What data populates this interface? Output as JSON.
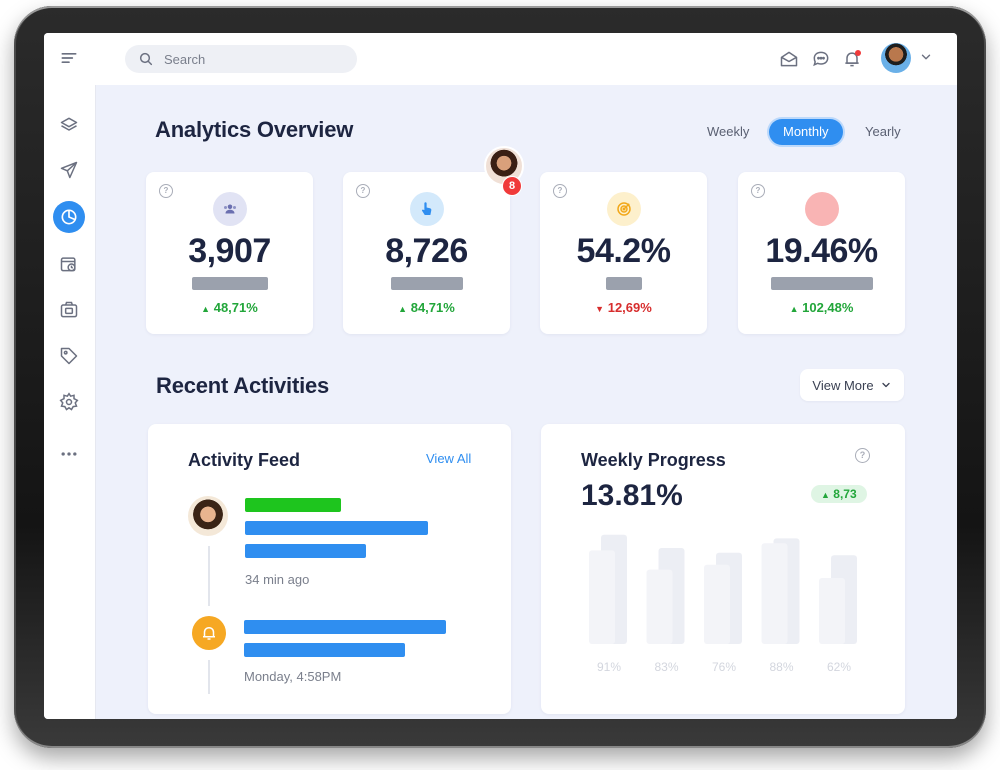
{
  "search": {
    "placeholder": "Search"
  },
  "sidebar": {
    "items": [
      {
        "name": "menu-icon"
      },
      {
        "name": "layers-icon"
      },
      {
        "name": "send-icon"
      },
      {
        "name": "pie-chart-icon",
        "active": true
      },
      {
        "name": "calendar-clock-icon"
      },
      {
        "name": "camera-icon"
      },
      {
        "name": "tag-icon"
      },
      {
        "name": "gear-icon"
      },
      {
        "name": "more-icon"
      }
    ]
  },
  "topbar": {
    "icons": [
      "mail-icon",
      "chat-icon",
      "bell-icon",
      "avatar",
      "chevron-down-icon"
    ]
  },
  "overview": {
    "title": "Analytics Overview",
    "periods": [
      "Weekly",
      "Monthly",
      "Yearly"
    ],
    "active_period": "Monthly",
    "notification_count": "8",
    "cards": [
      {
        "value": "3,907",
        "change": "48,71%",
        "trend": "up",
        "icon": "users-icon",
        "icon_bg": "#e1e3f4",
        "icon_color": "#6a6fb0"
      },
      {
        "value": "8,726",
        "change": "84,71%",
        "trend": "up",
        "icon": "pointer-icon",
        "icon_bg": "#d3e9fb",
        "icon_color": "#2f8ef0"
      },
      {
        "value": "54.2%",
        "change": "12,69%",
        "trend": "down",
        "icon": "target-icon",
        "icon_bg": "#fdf0cc",
        "icon_color": "#f2a81a"
      },
      {
        "value": "19.46%",
        "change": "102,48%",
        "trend": "up",
        "icon": "circle-icon",
        "icon_bg": "#f9b4b4",
        "icon_color": "#f9b4b4"
      }
    ]
  },
  "activities": {
    "title": "Recent Activities",
    "view_more": "View More",
    "feed": {
      "title": "Activity Feed",
      "view_all": "View All",
      "items": [
        {
          "time": "34  min ago"
        },
        {
          "time": "Monday, 4:58PM"
        }
      ]
    },
    "weekly": {
      "title": "Weekly Progress",
      "value": "13.81%",
      "change": "8,73",
      "bars": [
        {
          "label": "91%",
          "back": 0.91,
          "front": 0.78
        },
        {
          "label": "83%",
          "back": 0.8,
          "front": 0.62
        },
        {
          "label": "76%",
          "back": 0.76,
          "front": 0.66
        },
        {
          "label": "88%",
          "back": 0.88,
          "front": 0.84
        },
        {
          "label": "62%",
          "back": 0.74,
          "front": 0.55
        }
      ]
    }
  },
  "colors": {
    "accent": "#2f8ef0",
    "up": "#22a63a",
    "down": "#d72d2d",
    "feed_green": "#1ec51e"
  }
}
